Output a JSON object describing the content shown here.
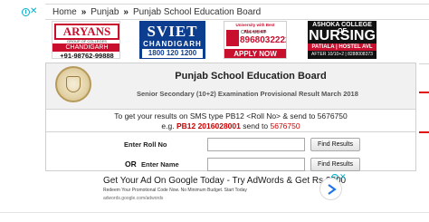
{
  "breadcrumb": {
    "items": [
      "Home",
      "Punjab",
      "Punjab School Education Board"
    ],
    "separator": "»"
  },
  "banners": {
    "aryans": {
      "name": "ARYANS",
      "subtitle": "GROUP OF COLLEGES",
      "city": "CHANDIGARH",
      "phone": "+91-98762-99888"
    },
    "sviet": {
      "name": "SVIET",
      "city": "CHANDIGARH",
      "phone": "1800 120 1200"
    },
    "univ": {
      "header": "University with Best Placements",
      "call": "CALL US AT",
      "phone": "8968032222",
      "cta": "APPLY NOW"
    },
    "ashoka": {
      "line1": "ASHOKA COLLEGE OF",
      "line2": "NURSING",
      "line3": "PATIALA | HOSTEL AVL",
      "line4": "AFTER 10/10+2 | 8288008373"
    }
  },
  "result": {
    "board_title": "Punjab School Education Board",
    "exam_title": "Senior Secondary (10+2) Examination Provisional Result March 2018",
    "sms_line1": "To get your results on SMS type PB12 <Roll No> & send to 5676750",
    "sms_example_prefix": "e.g.",
    "sms_example_code": "PB12 2016028001",
    "sms_example_mid": "send to",
    "sms_example_number": "5676750",
    "roll_label": "Enter Roll No",
    "or_label": "OR",
    "name_label": "Enter Name",
    "roll_value": "",
    "name_value": "",
    "button_label": "Find Results"
  },
  "ad": {
    "title": "Get Your Ad On Google Today - Try AdWords & Get Rs.2000",
    "description": "Redeem Your Promotional Code Now. No Minimum Budget. Start Today",
    "url": "adwords.google.com/adwords"
  },
  "colors": {
    "accent_red": "#cc0000",
    "adchoice": "#00aecd",
    "sviet_blue": "#0d3d8f"
  }
}
